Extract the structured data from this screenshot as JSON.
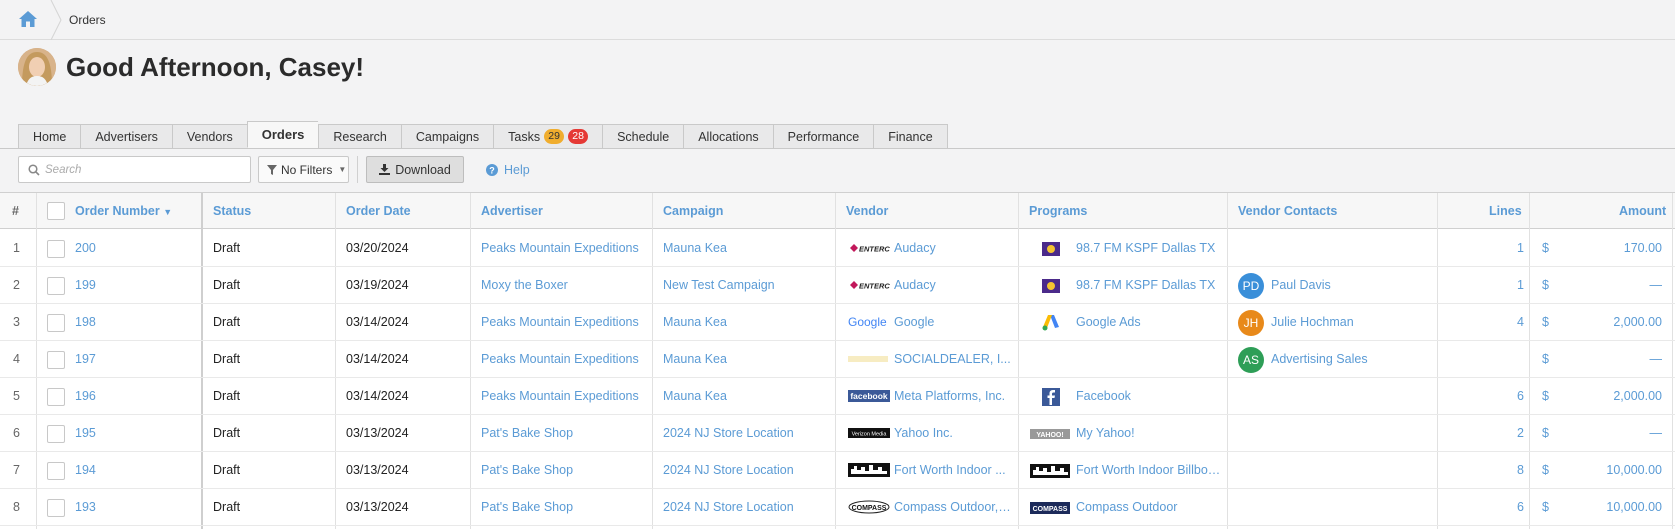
{
  "breadcrumb": {
    "current": "Orders"
  },
  "greeting": "Good Afternoon, Casey!",
  "tabs": [
    {
      "label": "Home"
    },
    {
      "label": "Advertisers"
    },
    {
      "label": "Vendors"
    },
    {
      "label": "Orders",
      "active": true
    },
    {
      "label": "Research"
    },
    {
      "label": "Campaigns"
    },
    {
      "label": "Tasks",
      "badges": [
        "29",
        "28"
      ]
    },
    {
      "label": "Schedule"
    },
    {
      "label": "Allocations"
    },
    {
      "label": "Performance"
    },
    {
      "label": "Finance"
    }
  ],
  "toolbar": {
    "search_placeholder": "Search",
    "filter_label": "No Filters",
    "download_label": "Download",
    "help_label": "Help"
  },
  "columns": {
    "num": "#",
    "order_number": "Order Number",
    "status": "Status",
    "order_date": "Order Date",
    "advertiser": "Advertiser",
    "campaign": "Campaign",
    "vendor": "Vendor",
    "programs": "Programs",
    "vendor_contacts": "Vendor Contacts",
    "lines": "Lines",
    "amount": "Amount"
  },
  "rows": [
    {
      "n": "1",
      "order": "200",
      "status": "Draft",
      "date": "03/20/2024",
      "advertiser": "Peaks Mountain Expeditions",
      "campaign": "Mauna Kea",
      "vendor": "Audacy",
      "program": "98.7 FM KSPF Dallas TX",
      "contact": "",
      "initials": "",
      "lines": "1",
      "currency": "$",
      "amount": "170.00"
    },
    {
      "n": "2",
      "order": "199",
      "status": "Draft",
      "date": "03/19/2024",
      "advertiser": "Moxy the Boxer",
      "campaign": "New Test Campaign",
      "vendor": "Audacy",
      "program": "98.7 FM KSPF Dallas TX",
      "contact": "Paul Davis",
      "initials": "PD",
      "lines": "1",
      "currency": "$",
      "amount": "—"
    },
    {
      "n": "3",
      "order": "198",
      "status": "Draft",
      "date": "03/14/2024",
      "advertiser": "Peaks Mountain Expeditions",
      "campaign": "Mauna Kea",
      "vendor": "Google",
      "program": "Google Ads",
      "contact": "Julie Hochman",
      "initials": "JH",
      "lines": "4",
      "currency": "$",
      "amount": "2,000.00"
    },
    {
      "n": "4",
      "order": "197",
      "status": "Draft",
      "date": "03/14/2024",
      "advertiser": "Peaks Mountain Expeditions",
      "campaign": "Mauna Kea",
      "vendor": "SOCIALDEALER, I...",
      "program": "",
      "contact": "Advertising Sales",
      "initials": "AS",
      "lines": "",
      "currency": "$",
      "amount": "—"
    },
    {
      "n": "5",
      "order": "196",
      "status": "Draft",
      "date": "03/14/2024",
      "advertiser": "Peaks Mountain Expeditions",
      "campaign": "Mauna Kea",
      "vendor": "Meta Platforms, Inc.",
      "program": "Facebook",
      "contact": "",
      "initials": "",
      "lines": "6",
      "currency": "$",
      "amount": "2,000.00"
    },
    {
      "n": "6",
      "order": "195",
      "status": "Draft",
      "date": "03/13/2024",
      "advertiser": "Pat's Bake Shop",
      "campaign": "2024 NJ Store Location",
      "vendor": "Yahoo Inc.",
      "program": "My Yahoo!",
      "contact": "",
      "initials": "",
      "lines": "2",
      "currency": "$",
      "amount": "—"
    },
    {
      "n": "7",
      "order": "194",
      "status": "Draft",
      "date": "03/13/2024",
      "advertiser": "Pat's Bake Shop",
      "campaign": "2024 NJ Store Location",
      "vendor": "Fort Worth Indoor ...",
      "program": "Fort Worth Indoor Billboa...",
      "contact": "",
      "initials": "",
      "lines": "8",
      "currency": "$",
      "amount": "10,000.00"
    },
    {
      "n": "8",
      "order": "193",
      "status": "Draft",
      "date": "03/13/2024",
      "advertiser": "Pat's Bake Shop",
      "campaign": "2024 NJ Store Location",
      "vendor": "Compass Outdoor, ...",
      "program": "Compass Outdoor",
      "contact": "",
      "initials": "",
      "lines": "6",
      "currency": "$",
      "amount": "10,000.00"
    }
  ],
  "logo_text": {
    "entercom": "ENTERCOM",
    "google": "Google",
    "facebook": "facebook",
    "verizon": "Verizon Media",
    "yahoo": "YAHOO!",
    "compass": "COMPASS"
  },
  "colors": {
    "link": "#5b9bd5",
    "pd": "#3a8fd9",
    "jh": "#e8891a",
    "as": "#2e9e57"
  }
}
